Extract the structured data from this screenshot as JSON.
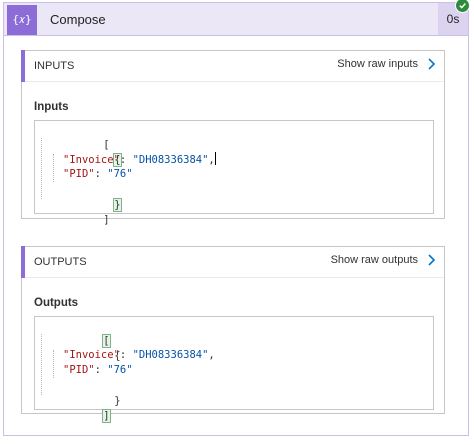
{
  "header": {
    "icon_text": "{𝑥}",
    "title": "Compose",
    "duration": "0s",
    "status": "succeeded"
  },
  "inputs_section": {
    "heading": "INPUTS",
    "raw_link": "Show raw inputs",
    "field_label": "Inputs",
    "code": {
      "open_array": "[",
      "open_object": "{",
      "invoice_key": "\"Invoice\"",
      "invoice_colon": ": ",
      "invoice_value": "\"DH08336384\"",
      "invoice_comma": ",",
      "pid_key": "\"PID\"",
      "pid_colon": ": ",
      "pid_value": "\"76\"",
      "close_object": "}",
      "close_array": "]"
    }
  },
  "outputs_section": {
    "heading": "OUTPUTS",
    "raw_link": "Show raw outputs",
    "field_label": "Outputs",
    "code": {
      "open_array": "[",
      "open_object": "{",
      "invoice_key": "\"Invoice\"",
      "invoice_colon": ": ",
      "invoice_value": "\"DH08336384\"",
      "invoice_comma": ",",
      "pid_key": "\"PID\"",
      "pid_colon": ": ",
      "pid_value": "\"76\"",
      "close_object": "}",
      "close_array": "]"
    }
  },
  "colors": {
    "accent": "#8c6cd6",
    "header_bg": "#ebe7f6",
    "success": "#2e8b3a",
    "json_key": "#a31515",
    "json_string": "#0451a5"
  }
}
